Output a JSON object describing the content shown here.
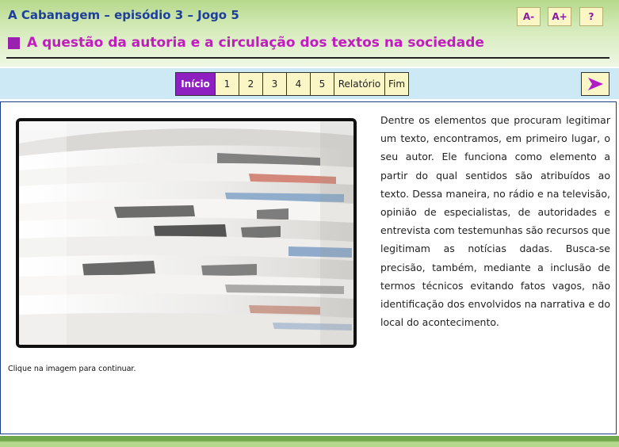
{
  "header": {
    "app_title": "A Cabanagem – episódio 3 – Jogo 5",
    "page_title": "A questão da autoria e a circulação dos textos na sociedade",
    "font_decrease_label": "A-",
    "font_increase_label": "A+",
    "help_label": "?"
  },
  "nav": {
    "items": [
      {
        "label": "Início",
        "active": true
      },
      {
        "label": "1"
      },
      {
        "label": "2"
      },
      {
        "label": "3"
      },
      {
        "label": "4"
      },
      {
        "label": "5"
      },
      {
        "label": "Relatório"
      },
      {
        "label": "Fim"
      }
    ],
    "next_icon": "play-arrow-icon"
  },
  "content": {
    "image_subject": "newspaper-stack",
    "body_text": "Dentre os elementos que procuram legitimar um texto, encontramos, em primeiro lugar, o seu autor. Ele funciona como elemento a partir do qual sentidos são atribuídos ao texto. Dessa maneira, no rádio e na televisão, opinião de especialistas, de autoridades e entrevista com testemunhas são recursos que legitimam as notícias dadas. Busca-se precisão, também, mediante a inclusão de termos técnicos evitando fatos vagos, não identificação dos envolvidos na narrativa e do local do acontecimento.",
    "hint": "Clique na imagem para continuar."
  },
  "colors": {
    "accent_purple": "#8e1fc0",
    "title_magenta": "#c21bc0",
    "header_green": "#b6d98a",
    "nav_blue": "#cde9f6",
    "button_cream": "#fbf6c6",
    "app_title_blue": "#1d3f9a"
  }
}
